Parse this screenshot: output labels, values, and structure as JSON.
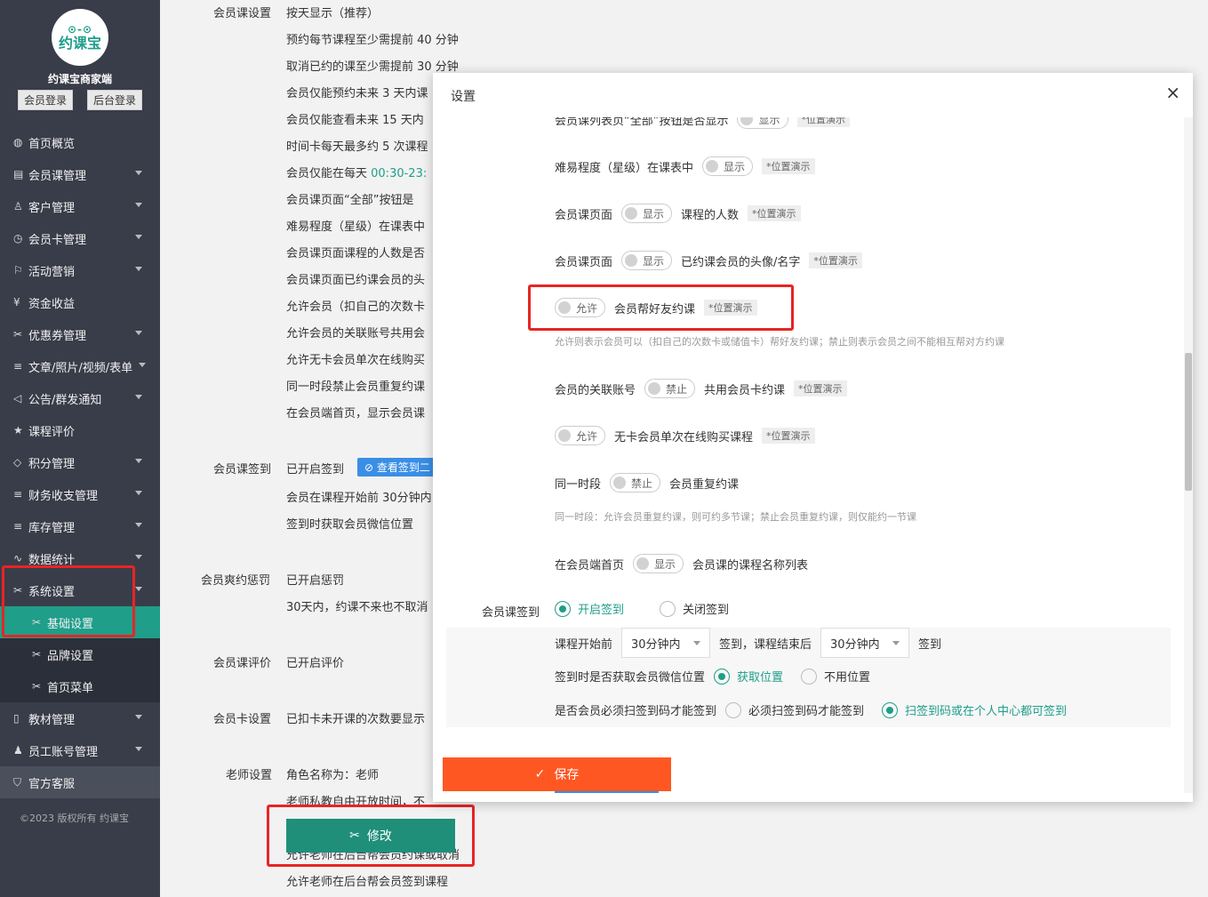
{
  "sidebar": {
    "logo_text": "约课宝",
    "brand_title": "约课宝商家端",
    "member_login": "会员登录",
    "admin_login": "后台登录",
    "items": [
      {
        "label": "首页概览",
        "icon": "globe-icon"
      },
      {
        "label": "会员课管理",
        "icon": "document-icon"
      },
      {
        "label": "客户管理",
        "icon": "user-icon"
      },
      {
        "label": "会员卡管理",
        "icon": "clock-icon"
      },
      {
        "label": "活动营销",
        "icon": "flag-icon"
      },
      {
        "label": "资金收益",
        "icon": "yen-icon"
      },
      {
        "label": "优惠券管理",
        "icon": "tools-icon"
      },
      {
        "label": "文章/照片/视频/表单",
        "icon": "sliders-icon"
      },
      {
        "label": "公告/群发通知",
        "icon": "speaker-icon"
      },
      {
        "label": "课程评价",
        "icon": "star-icon"
      },
      {
        "label": "积分管理",
        "icon": "diamond-icon"
      },
      {
        "label": "财务收支管理",
        "icon": "sliders-icon"
      },
      {
        "label": "库存管理",
        "icon": "sliders-icon"
      },
      {
        "label": "数据统计",
        "icon": "pulse-icon"
      },
      {
        "label": "系统设置",
        "icon": "tools-icon"
      },
      {
        "label": "基础设置",
        "icon": "tools-icon"
      },
      {
        "label": "品牌设置",
        "icon": "tools-icon"
      },
      {
        "label": "首页菜单",
        "icon": "tools-icon"
      },
      {
        "label": "教材管理",
        "icon": "book-icon"
      },
      {
        "label": "员工账号管理",
        "icon": "person-icon"
      },
      {
        "label": "官方客服",
        "icon": "shield-icon"
      }
    ],
    "copyright": "©2023 版权所有 约课宝"
  },
  "main": {
    "course_settings_label": "会员课设置",
    "course_settings_lines": [
      "按天显示（推荐）",
      "预约每节课程至少需提前 40 分钟",
      "取消已约的课至少需提前 30 分钟",
      "会员仅能预约未来 3 天内课",
      "会员仅能查看未来 15 天内",
      "时间卡每天最多约 5 次课程",
      "会员仅能在每天 ",
      "会员课页面“全部”按钮是",
      "难易程度（星级）在课表中",
      "会员课页面课程的人数是否",
      "会员课页面已约课会员的头",
      "允许会员（扣自己的次数卡",
      "允许会员的关联账号共用会",
      "允许无卡会员单次在线购买",
      "同一时段禁止会员重复约课",
      "在会员端首页，显示会员课"
    ],
    "time_range": "00:30-23:",
    "signin_label": "会员课签到",
    "signin_lines": [
      "已开启签到",
      "会员在课程开始前 30分钟内",
      "签到时获取会员微信位置"
    ],
    "view_signin_btn": "查看签到二",
    "penalty_label": "会员爽约惩罚",
    "penalty_lines": [
      "已开启惩罚",
      "30天内，约课不来也不取消"
    ],
    "review_label": "会员课评价",
    "review_line": "已开启评价",
    "card_label": "会员卡设置",
    "card_line": "已扣卡未开课的次数要显示",
    "teacher_label": "老师设置",
    "teacher_lines": [
      "角色名称为：老师",
      "老师私教自由开放时间，不",
      "允许老师在后台帮会员约课或取消",
      "允许老师在后台帮会员签到课程"
    ],
    "edit_button": "修改"
  },
  "modal": {
    "title": "设置",
    "close": "×",
    "rows": {
      "r0_label": "会员课列表页“全部”按钮是否显示",
      "r0_switch": "显示",
      "r0_demo": "*位置演示",
      "r1_label": "难易程度（星级）在课表中",
      "r1_switch": "显示",
      "r1_demo": "*位置演示",
      "r2_label": "会员课页面",
      "r2_switch": "显示",
      "r2_after": "课程的人数",
      "r2_demo": "*位置演示",
      "r3_label": "会员课页面",
      "r3_switch": "显示",
      "r3_after": "已约课会员的头像/名字",
      "r3_demo": "*位置演示",
      "r4_switch": "允许",
      "r4_after": "会员帮好友约课",
      "r4_demo": "*位置演示",
      "r4_hint": "允许则表示会员可以（扣自己的次数卡或储值卡）帮好友约课；禁止则表示会员之间不能相互帮对方约课",
      "r5_label": "会员的关联账号",
      "r5_switch": "禁止",
      "r5_after": "共用会员卡约课",
      "r5_demo": "*位置演示",
      "r6_switch": "允许",
      "r6_after": "无卡会员单次在线购买课程",
      "r6_demo": "*位置演示",
      "r7_label": "同一时段",
      "r7_switch": "禁止",
      "r7_after": "会员重复约课",
      "r7_hint": "同一时段：允许会员重复约课，则可约多节课；禁止会员重复约课，则仅能约一节课",
      "r8_label": "在会员端首页",
      "r8_switch": "显示",
      "r8_after": "会员课的课程名称列表"
    },
    "signin": {
      "label": "会员课签到",
      "open": "开启签到",
      "close": "关闭签到",
      "before_label": "课程开始前",
      "before_value": "30分钟内",
      "mid_label": "签到，课程结束后",
      "after_value": "30分钟内",
      "end_label": "签到",
      "loc_label": "签到时是否获取会员微信位置",
      "loc_yes": "获取位置",
      "loc_no": "不用位置",
      "scan_label": "是否会员必须扫签到码才能签到",
      "scan_must": "必须扫签到码才能签到",
      "scan_either": "扫签到码或在个人中心都可签到"
    },
    "save_button": "保存"
  },
  "colors": {
    "sidebar_bg": "#393d49",
    "accent": "#1f9e8a",
    "save": "#ff5722",
    "highlight": "#e82424"
  }
}
